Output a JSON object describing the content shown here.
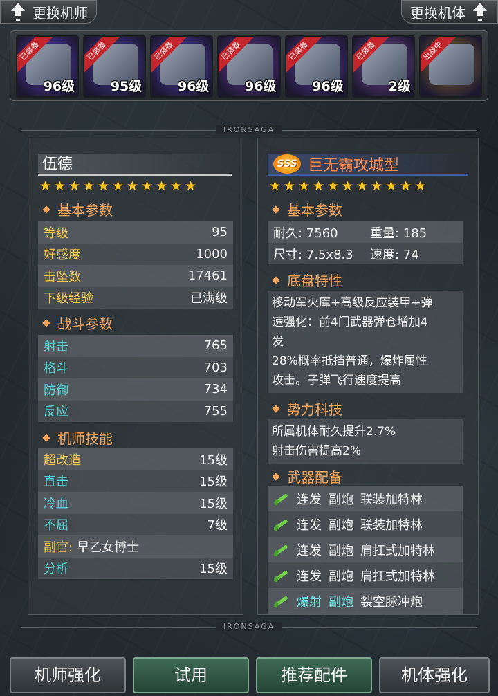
{
  "topbar": {
    "change_pilot": "更换机师",
    "change_mech": "更换机体"
  },
  "equipment": [
    {
      "tag": "已装备",
      "level": "96级",
      "color": "#5b3ec4"
    },
    {
      "tag": "已装备",
      "level": "95级",
      "color": "#4a3fa8"
    },
    {
      "tag": "已装备",
      "level": "96级",
      "color": "#5543b8"
    },
    {
      "tag": "已装备",
      "level": "96级",
      "color": "#6a3a9a"
    },
    {
      "tag": "已装备",
      "level": "96级",
      "color": "#5a3aa0"
    },
    {
      "tag": "已装备",
      "level": "2级",
      "color": "#7a4a9a"
    },
    {
      "tag": "出战中",
      "level": "",
      "color": "#8a6a2a"
    }
  ],
  "divider_label": "IRONSAGA",
  "pilot": {
    "name": "伍德",
    "stars": 11,
    "basic_title": "基本参数",
    "basic": [
      {
        "k": "等级",
        "v": "95"
      },
      {
        "k": "好感度",
        "v": "1000"
      },
      {
        "k": "击坠数",
        "v": "17461"
      },
      {
        "k": "下级经验",
        "v": "已满级"
      }
    ],
    "combat_title": "战斗参数",
    "combat": [
      {
        "k": "射击",
        "v": "765"
      },
      {
        "k": "格斗",
        "v": "703"
      },
      {
        "k": "防御",
        "v": "734"
      },
      {
        "k": "反应",
        "v": "755"
      }
    ],
    "skill_title": "机师技能",
    "skills": [
      {
        "k": "超改造",
        "v": "15级",
        "c": "gold"
      },
      {
        "k": "直击",
        "v": "15级",
        "c": "cyan"
      },
      {
        "k": "冷血",
        "v": "15级",
        "c": "cyan"
      },
      {
        "k": "不屈",
        "v": "7级",
        "c": "cyan"
      }
    ],
    "adjutant_label": "副官:",
    "adjutant_value": "早乙女博士",
    "extra_skill": {
      "k": "分析",
      "v": "15级"
    }
  },
  "mech": {
    "rank": "SSS",
    "name": "巨无霸攻城型",
    "stars": 11,
    "basic_title": "基本参数",
    "stats": [
      {
        "a": "耐久: 7560",
        "b": "重量: 185"
      },
      {
        "a": "尺寸: 7.5x8.3",
        "b": "速度: 74"
      }
    ],
    "chassis_title": "底盘特性",
    "chassis_text": "移动军火库+高级反应装甲+弹速强化：前4门武器弹仓增加4发 28%概率抵挡普通，爆炸属性攻击。子弹飞行速度提高",
    "chassis_lines": [
      "移动军火库+高级反应装甲+弹",
      "速强化：前4门武器弹仓增加4",
      "发",
      "28%概率抵挡普通，爆炸属性",
      "攻击。子弹飞行速度提高"
    ],
    "faction_title": "势力科技",
    "faction_lines": [
      "所属机体耐久提升2.7%",
      "射击伤害提高2%"
    ],
    "weapons_title": "武器配备",
    "weapons": [
      {
        "mode": "连发",
        "type": "副炮",
        "name": "联装加特林",
        "special": false
      },
      {
        "mode": "连发",
        "type": "副炮",
        "name": "联装加特林",
        "special": false
      },
      {
        "mode": "连发",
        "type": "副炮",
        "name": "肩扛式加特林",
        "special": false
      },
      {
        "mode": "连发",
        "type": "副炮",
        "name": "肩扛式加特林",
        "special": false
      },
      {
        "mode": "爆射",
        "type": "副炮",
        "name": "裂空脉冲炮",
        "special": true
      }
    ]
  },
  "buttons": {
    "pilot_enhance": "机师强化",
    "trial": "试用",
    "recommend_parts": "推荐配件",
    "mech_enhance": "机体强化"
  }
}
